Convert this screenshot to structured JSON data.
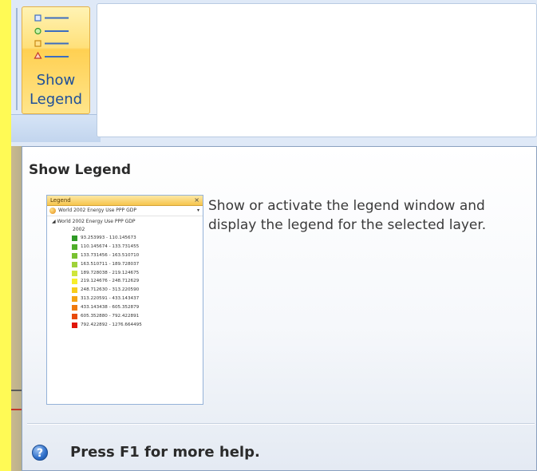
{
  "ribbon": {
    "button_label_line1": "Show",
    "button_label_line2": "Legend"
  },
  "tooltip": {
    "title": "Show Legend",
    "description": "Show or activate the legend window and display the legend for the selected layer.",
    "help_text": "Press F1 for more help.",
    "help_icon": "?"
  },
  "legend_preview": {
    "header": "Legend",
    "close": "×",
    "selected_layer": "World 2002 Energy Use PPP GDP",
    "layer_name": "World 2002 Energy Use PPP GDP",
    "field": "2002",
    "classes": [
      {
        "label": "93.253993 - 110.145673",
        "color": "#2f9a26"
      },
      {
        "label": "110.145674 - 133.731455",
        "color": "#4fae2a"
      },
      {
        "label": "133.731456 - 163.510710",
        "color": "#79c232"
      },
      {
        "label": "163.510711 - 189.728037",
        "color": "#9fd23a"
      },
      {
        "label": "189.728038 - 219.124675",
        "color": "#cfe53c"
      },
      {
        "label": "219.124676 - 248.712629",
        "color": "#f7ee2a"
      },
      {
        "label": "248.712630 - 313.220590",
        "color": "#f8cd1a"
      },
      {
        "label": "313.220591 - 433.143437",
        "color": "#f5a312"
      },
      {
        "label": "433.143438 - 605.352879",
        "color": "#f07a0c"
      },
      {
        "label": "605.352880 - 792.422891",
        "color": "#e84a0a"
      },
      {
        "label": "792.422892 - 1276.664495",
        "color": "#e0160a"
      }
    ]
  }
}
